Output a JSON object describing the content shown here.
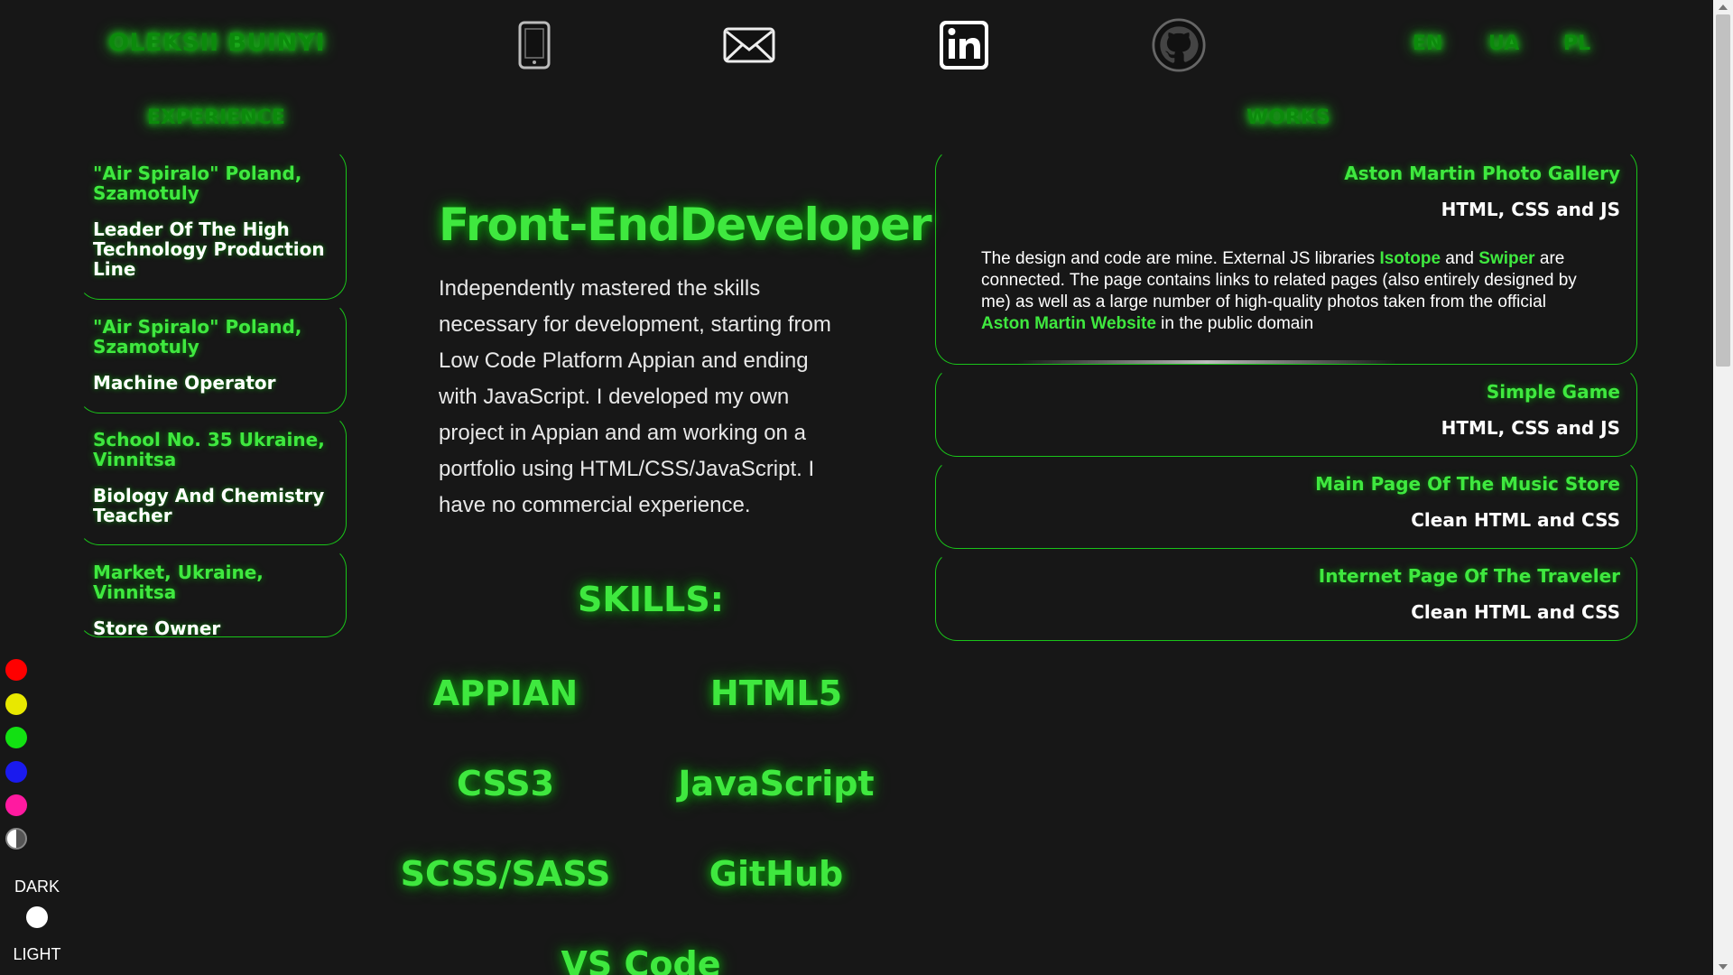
{
  "header": {
    "name": "OLEKSII BUINYI",
    "icons": [
      "phone-icon",
      "mail-icon",
      "linkedin-icon",
      "github-icon"
    ],
    "languages": [
      "EN",
      "UA",
      "PL"
    ]
  },
  "experience": {
    "title": "EXPERIENCE",
    "items": [
      {
        "company": "\"Air Spiralo\" Poland, Szamotuly",
        "role": "Leader Of The High Technology Production Line"
      },
      {
        "company": "\"Air Spiralo\" Poland, Szamotuly",
        "role": "Machine Operator"
      },
      {
        "company": "School No. 35 Ukraine, Vinnitsa",
        "role": "Biology And Chemistry Teacher"
      },
      {
        "company": "Market, Ukraine, Vinnitsa",
        "role": "Store Owner"
      }
    ]
  },
  "main": {
    "title": "Front-EndDeveloper",
    "about": "Independently mastered the skills necessary for development, starting from Low Code Platform Appian and ending with JavaScript. I developed my own project in Appian and am working on a portfolio using HTML/CSS/JavaScript. I have no commercial experience.",
    "skills_title": "SKILLS:",
    "skills": [
      "APPIAN",
      "HTML5",
      "CSS3",
      "JavaScript",
      "SCSS/SASS",
      "GitHub",
      "VS Code"
    ]
  },
  "works": {
    "title": "WORKS",
    "items": [
      {
        "title": "Aston Martin Photo Gallery",
        "tech": "HTML, CSS and JS",
        "desc_parts": {
          "p1": "The design and code are mine. External JS libraries ",
          "b1": "Isotope",
          "p2": " and ",
          "b2": "Swiper",
          "p3": " are connected. The page contains links to related pages (also entirely designed by me) as well as a large number of high-quality photos taken from the official ",
          "b3": "Aston Martin Website",
          "p4": " in the public domain"
        }
      },
      {
        "title": "Simple Game",
        "tech": "HTML, CSS and JS"
      },
      {
        "title": "Main Page Of The Music Store",
        "tech": "Clean HTML and CSS"
      },
      {
        "title": "Internet Page Of The Traveler",
        "tech": "Clean HTML and CSS"
      }
    ]
  },
  "theme": {
    "colors": [
      "#ff0000",
      "#e8e800",
      "#12e012",
      "#1a1aee",
      "#ff1aa0"
    ],
    "contrast_icon": "half-circle-icon",
    "dark_label": "DARK",
    "light_label": "LIGHT"
  }
}
